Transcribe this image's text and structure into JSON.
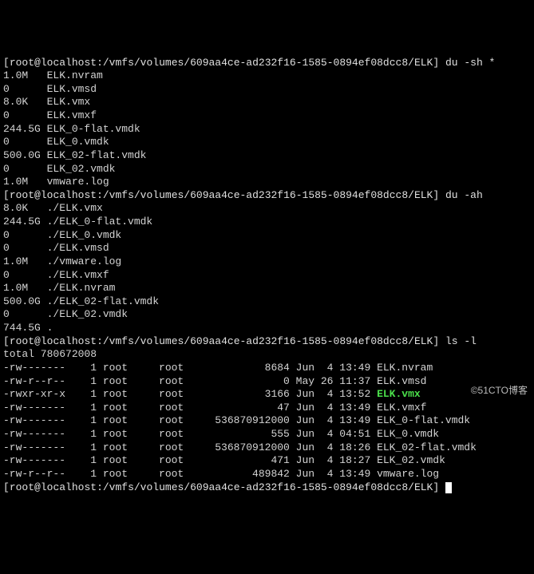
{
  "prompt": {
    "user": "root",
    "host": "localhost",
    "path": "/vmfs/volumes/609aa4ce-ad232f16-1585-0894ef08dcc8/ELK"
  },
  "commands": {
    "c0": "du -sh *",
    "c1": "du -ah",
    "c2": "ls -l",
    "c3": ""
  },
  "du_sh": [
    {
      "size": "1.0M",
      "name": "ELK.nvram"
    },
    {
      "size": "0",
      "name": "ELK.vmsd"
    },
    {
      "size": "8.0K",
      "name": "ELK.vmx"
    },
    {
      "size": "0",
      "name": "ELK.vmxf"
    },
    {
      "size": "244.5G",
      "name": "ELK_0-flat.vmdk"
    },
    {
      "size": "0",
      "name": "ELK_0.vmdk"
    },
    {
      "size": "500.0G",
      "name": "ELK_02-flat.vmdk"
    },
    {
      "size": "0",
      "name": "ELK_02.vmdk"
    },
    {
      "size": "1.0M",
      "name": "vmware.log"
    }
  ],
  "du_ah": [
    {
      "size": "8.0K",
      "name": "./ELK.vmx"
    },
    {
      "size": "244.5G",
      "name": "./ELK_0-flat.vmdk"
    },
    {
      "size": "0",
      "name": "./ELK_0.vmdk"
    },
    {
      "size": "0",
      "name": "./ELK.vmsd"
    },
    {
      "size": "1.0M",
      "name": "./vmware.log"
    },
    {
      "size": "0",
      "name": "./ELK.vmxf"
    },
    {
      "size": "1.0M",
      "name": "./ELK.nvram"
    },
    {
      "size": "500.0G",
      "name": "./ELK_02-flat.vmdk"
    },
    {
      "size": "0",
      "name": "./ELK_02.vmdk"
    },
    {
      "size": "744.5G",
      "name": "."
    }
  ],
  "ls_total": "total 780672008",
  "ls_l": [
    {
      "perm": "-rw-------",
      "links": "1",
      "owner": "root",
      "group": "root",
      "size": "8684",
      "date": "Jun  4 13:49",
      "name": "ELK.nvram",
      "hl": false
    },
    {
      "perm": "-rw-r--r--",
      "links": "1",
      "owner": "root",
      "group": "root",
      "size": "0",
      "date": "May 26 11:37",
      "name": "ELK.vmsd",
      "hl": false
    },
    {
      "perm": "-rwxr-xr-x",
      "links": "1",
      "owner": "root",
      "group": "root",
      "size": "3166",
      "date": "Jun  4 13:52",
      "name": "ELK.vmx",
      "hl": true
    },
    {
      "perm": "-rw-------",
      "links": "1",
      "owner": "root",
      "group": "root",
      "size": "47",
      "date": "Jun  4 13:49",
      "name": "ELK.vmxf",
      "hl": false
    },
    {
      "perm": "-rw-------",
      "links": "1",
      "owner": "root",
      "group": "root",
      "size": "536870912000",
      "date": "Jun  4 13:49",
      "name": "ELK_0-flat.vmdk",
      "hl": false
    },
    {
      "perm": "-rw-------",
      "links": "1",
      "owner": "root",
      "group": "root",
      "size": "555",
      "date": "Jun  4 04:51",
      "name": "ELK_0.vmdk",
      "hl": false
    },
    {
      "perm": "-rw-------",
      "links": "1",
      "owner": "root",
      "group": "root",
      "size": "536870912000",
      "date": "Jun  4 18:26",
      "name": "ELK_02-flat.vmdk",
      "hl": false
    },
    {
      "perm": "-rw-------",
      "links": "1",
      "owner": "root",
      "group": "root",
      "size": "471",
      "date": "Jun  4 18:27",
      "name": "ELK_02.vmdk",
      "hl": false
    },
    {
      "perm": "-rw-r--r--",
      "links": "1",
      "owner": "root",
      "group": "root",
      "size": "489842",
      "date": "Jun  4 13:49",
      "name": "vmware.log",
      "hl": false
    }
  ],
  "watermark": "©51CTO博客"
}
